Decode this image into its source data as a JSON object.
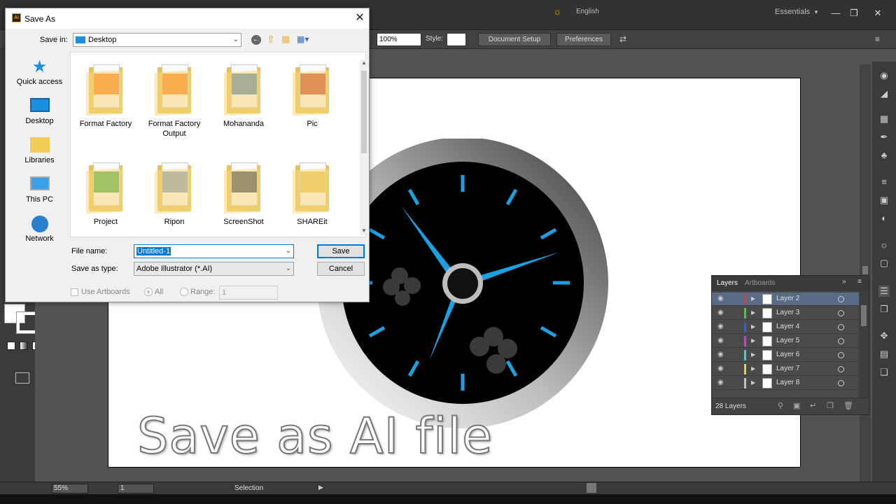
{
  "topbar": {
    "essentials": "Essentials",
    "english": "English",
    "minimize": "—",
    "restore": "❐",
    "close": "✕"
  },
  "controlbar": {
    "zoom": "100%",
    "style_label": "Style:",
    "document_setup": "Document Setup",
    "preferences": "Preferences"
  },
  "dialog": {
    "title": "Save As",
    "app_icon": "Ai",
    "save_in_label": "Save in:",
    "save_in_value": "Desktop",
    "places": [
      "Quick access",
      "Desktop",
      "Libraries",
      "This PC",
      "Network"
    ],
    "files": [
      {
        "name": "Format Factory",
        "name2": ""
      },
      {
        "name": "Format Factory",
        "name2": "Output"
      },
      {
        "name": "Mohananda",
        "name2": ""
      },
      {
        "name": "Pic",
        "name2": ""
      },
      {
        "name": "Project",
        "name2": ""
      },
      {
        "name": "Ripon",
        "name2": ""
      },
      {
        "name": "ScreenShot",
        "name2": ""
      },
      {
        "name": "SHAREit",
        "name2": ""
      }
    ],
    "file_name_label": "File name:",
    "file_name_value": "Untitled-1",
    "save_type_label": "Save as type:",
    "save_type_value": "Adobe Illustrator (*.AI)",
    "save_button": "Save",
    "cancel_button": "Cancel",
    "use_artboards": "Use Artboards",
    "all": "All",
    "range": "Range:",
    "range_value": "1"
  },
  "canvas": {
    "overlay_text": "Save as AI file"
  },
  "layers": {
    "tab_layers": "Layers",
    "tab_artboards": "Artboards",
    "count": "28 Layers",
    "rows": [
      {
        "name": "Layer 2",
        "color": "#e23a3a"
      },
      {
        "name": "Layer 3",
        "color": "#3ad13a"
      },
      {
        "name": "Layer 4",
        "color": "#3a5ae2"
      },
      {
        "name": "Layer 5",
        "color": "#d43ad4"
      },
      {
        "name": "Layer 6",
        "color": "#3ad4d4"
      },
      {
        "name": "Layer 7",
        "color": "#e2d43a"
      },
      {
        "name": "Layer 8",
        "color": "#c0c0c0"
      }
    ]
  },
  "status": {
    "zoom": "55%",
    "page": "1",
    "tool": "Selection"
  },
  "colors": {
    "accent_blue": "#1ba1e2",
    "selection": "#5a6b87"
  }
}
